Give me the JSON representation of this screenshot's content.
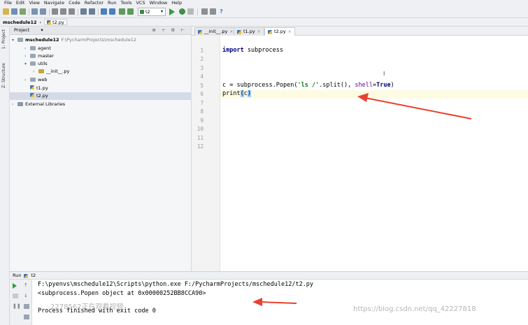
{
  "menu": [
    "File",
    "Edit",
    "View",
    "Navigate",
    "Code",
    "Refactor",
    "Run",
    "Tools",
    "VCS",
    "Window",
    "Help"
  ],
  "toolbar": {
    "run_config": "t2"
  },
  "breadcrumbs": {
    "project": "mschedule12",
    "file": "t2.py"
  },
  "side_labels": {
    "project": "1: Project",
    "structure": "Z: Structure"
  },
  "project_panel": {
    "header": "Project",
    "tools": "⊕ ÷ ⚙ ⊢",
    "root_name": "mschedule12",
    "root_path": "F:\\PycharmProjects\\mschedule12",
    "items": [
      "agent",
      "master",
      "utils",
      "__init__.py",
      "web",
      "t1.py",
      "t2.py"
    ],
    "external": "External Libraries"
  },
  "editor": {
    "tabs": [
      "__init__.py",
      "t1.py",
      "t2.py"
    ],
    "line_numbers": [
      "1",
      "2",
      "3",
      "4",
      "5",
      "6",
      "7",
      "8",
      "9",
      "10",
      "11",
      "12"
    ],
    "code": {
      "l1_kw": "import",
      "l1_rest": " subprocess",
      "l5_a": "c = subprocess.Popen(",
      "l5_str": "'ls /'",
      "l5_b": ".split(), ",
      "l5_param": "shell",
      "l5_eq": "=",
      "l5_true": "True",
      "l5_end": ")",
      "l6_a": "print",
      "l6_open": "(",
      "l6_arg": "c",
      "l6_close": ")"
    }
  },
  "run": {
    "title": "Run",
    "config": "t2",
    "console": [
      "F:\\pyenvs\\mschedule12\\Scripts\\python.exe F:/PycharmProjects/mschedule12/t2.py",
      "<subprocess.Popen object at 0x00000252BB8CCA90>",
      "",
      "Process finished with exit code 0"
    ]
  },
  "watermarks": {
    "left": "2278562正在观看视频",
    "right": "https://blog.csdn.net/qq_42227818"
  },
  "colors": {
    "annotation_arrow": "#e8412e",
    "keyword": "#000080",
    "string": "#008000",
    "parameter": "#660099"
  }
}
